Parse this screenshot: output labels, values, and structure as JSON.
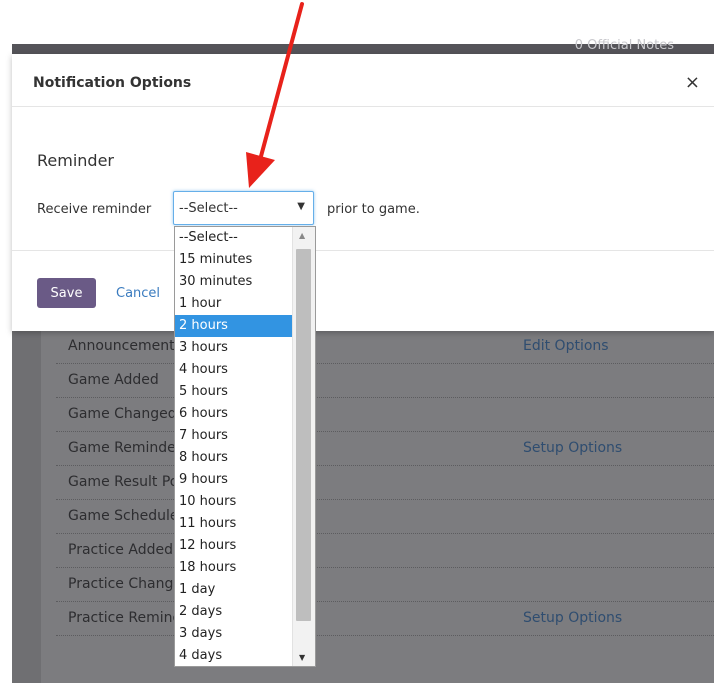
{
  "background": {
    "topbar_text": "0  Official Notes",
    "rows": [
      {
        "name": "Announcement",
        "option": "Edit Options"
      },
      {
        "name": "Game Added",
        "option": ""
      },
      {
        "name": "Game Changed",
        "option": ""
      },
      {
        "name": "Game Reminder",
        "option": "Setup Options"
      },
      {
        "name": "Game Result Posted",
        "option": ""
      },
      {
        "name": "Game Schedule",
        "option": ""
      },
      {
        "name": "Practice Added",
        "option": ""
      },
      {
        "name": "Practice Changed",
        "option": ""
      },
      {
        "name": "Practice Reminder",
        "option": "Setup Options"
      }
    ]
  },
  "modal": {
    "title": "Notification Options",
    "close_label": "×",
    "section_title": "Reminder",
    "receive_label": "Receive reminder",
    "select_value": "--Select--",
    "suffix_label": "prior to game.",
    "save_label": "Save",
    "cancel_label": "Cancel"
  },
  "dropdown": {
    "selected_index": 4,
    "options": [
      "--Select--",
      "15 minutes",
      "30 minutes",
      "1 hour",
      "2 hours",
      "3 hours",
      "4 hours",
      "5 hours",
      "6 hours",
      "7 hours",
      "8 hours",
      "9 hours",
      "10 hours",
      "11 hours",
      "12 hours",
      "18 hours",
      "1 day",
      "2 days",
      "3 days",
      "4 days"
    ]
  },
  "colors": {
    "accent": "#6a5a86",
    "highlight": "#3294e2",
    "annotation_arrow": "#e8221b"
  }
}
